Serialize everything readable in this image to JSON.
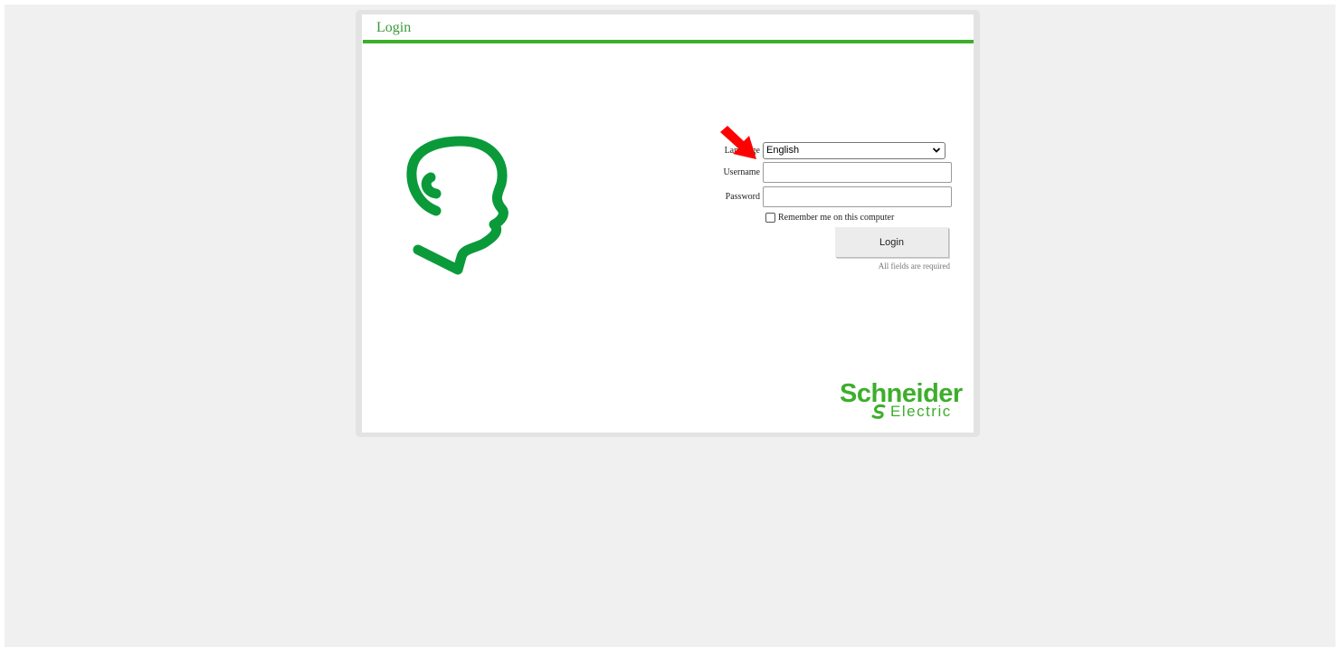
{
  "panel": {
    "title": "Login"
  },
  "form": {
    "language_label": "Language",
    "language_value": "English",
    "username_label": "Username",
    "username_value": "",
    "password_label": "Password",
    "password_value": "",
    "remember_label": "Remember me on this computer",
    "remember_checked": false,
    "login_button": "Login",
    "required_note": "All fields are required"
  },
  "brand": {
    "name": "Schneider",
    "sub": "Electric"
  },
  "colors": {
    "brand_green": "#3dae2b",
    "logo_green": "#0a9a3a",
    "arrow_red": "#ff0000"
  },
  "icons": [
    "head-profile-logo",
    "chevron-down-icon",
    "red-arrow-icon",
    "schneider-mark-icon"
  ]
}
